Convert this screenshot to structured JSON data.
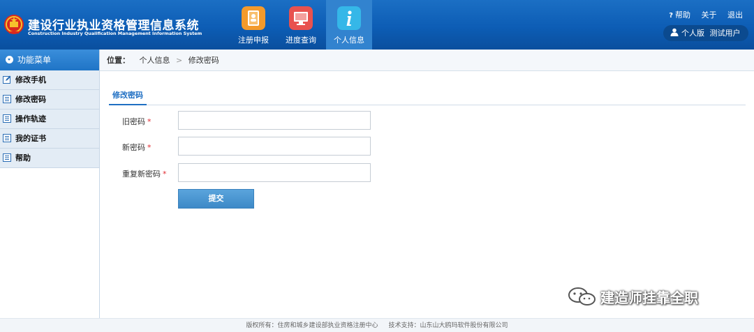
{
  "header": {
    "title": "建设行业执业资格管理信息系统",
    "subtitle": "Construction Industry Qualification Management Information System",
    "tabs": [
      {
        "label": "注册申报",
        "icon": "registration-book-icon",
        "color": "#f39a2b"
      },
      {
        "label": "进度查询",
        "icon": "monitor-progress-icon",
        "color": "#e8524f"
      },
      {
        "label": "个人信息",
        "icon": "info-icon",
        "color": "#35b7e8",
        "active": true
      }
    ],
    "links": {
      "help": "帮助",
      "about": "关于",
      "logout": "退出"
    },
    "user": {
      "version": "个人版",
      "name": "测试用户"
    }
  },
  "sidebar": {
    "header": "功能菜单",
    "items": [
      {
        "label": "修改手机",
        "icon": "edit-icon"
      },
      {
        "label": "修改密码",
        "icon": "list-icon"
      },
      {
        "label": "操作轨迹",
        "icon": "list-icon"
      },
      {
        "label": "我的证书",
        "icon": "list-icon"
      },
      {
        "label": "帮助",
        "icon": "list-icon"
      }
    ]
  },
  "breadcrumb": {
    "label": "位置：",
    "items": [
      "个人信息",
      "修改密码"
    ],
    "separator": ">"
  },
  "form": {
    "tab_title": "修改密码",
    "fields": [
      {
        "label": "旧密码",
        "required_mark": "*",
        "value": ""
      },
      {
        "label": "新密码",
        "required_mark": "*",
        "value": ""
      },
      {
        "label": "重复新密码",
        "required_mark": "*",
        "value": ""
      }
    ],
    "submit_label": "提交"
  },
  "watermark": "建造师挂靠全职",
  "footer": {
    "copyright": "版权所有：住房和城乡建设部执业资格注册中心",
    "support": "技术支持：山东山大鸥玛软件股份有限公司"
  },
  "colors": {
    "header_blue": "#0d5db5",
    "active_tab": "#3283cf",
    "accent": "#1f6fc3",
    "required": "#e0292f",
    "button": "#4592cf"
  }
}
